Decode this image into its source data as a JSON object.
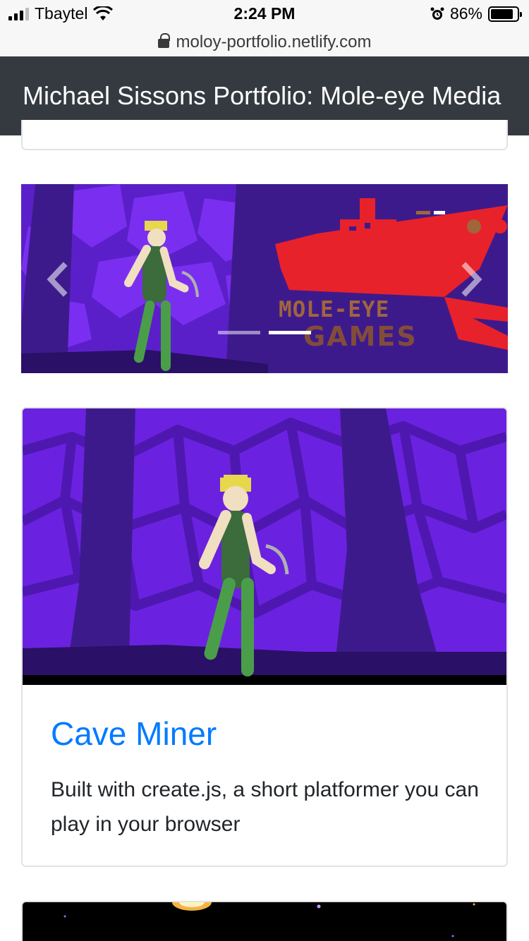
{
  "status_bar": {
    "carrier": "Tbaytel",
    "time": "2:24 PM",
    "battery_percent": "86%",
    "battery_level": 0.86
  },
  "browser": {
    "url": "moloy-portfolio.netlify.com"
  },
  "navbar": {
    "brand": "Michael Sissons Portfolio: Mole-eye Media"
  },
  "carousel": {
    "logo_line1": "MOLE-EYE",
    "logo_line2": "GAMES",
    "slide_count": 2,
    "active_slide": 2
  },
  "project": {
    "title": "Cave Miner",
    "description": "Built with create.js, a short platformer you can play in your browser"
  },
  "colors": {
    "navbar": "#343a40",
    "link": "#007bff",
    "cave_purple": "#6a22e0",
    "cave_dark": "#3d1a8c",
    "submarine_red": "#e8222a"
  }
}
